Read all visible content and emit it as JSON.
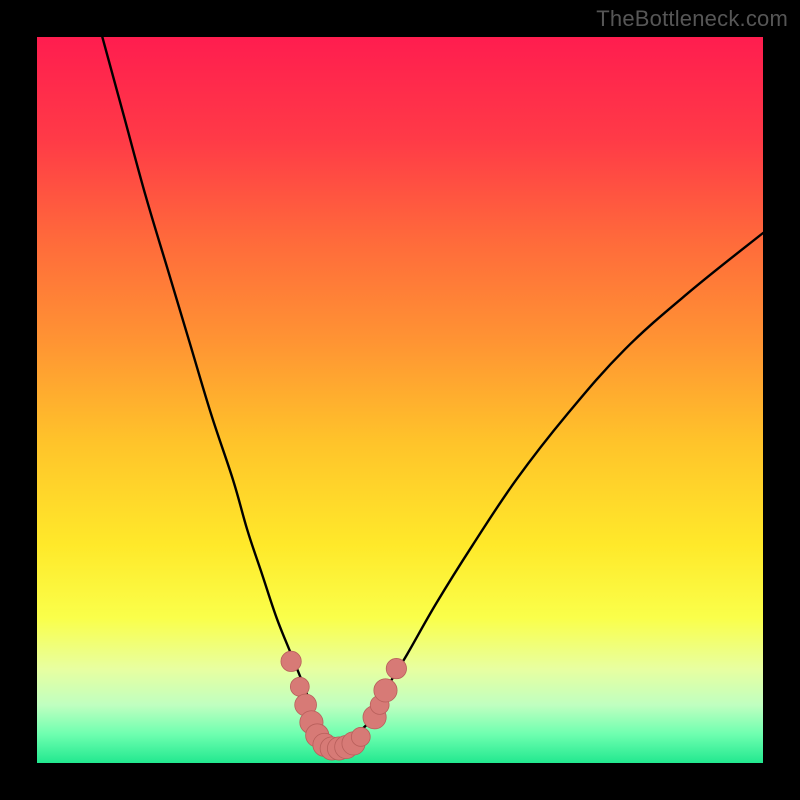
{
  "attribution": "TheBottleneck.com",
  "colors": {
    "black": "#000000",
    "curve": "#000000",
    "marker_fill": "#d77a76",
    "marker_stroke": "#b85f5b",
    "gradient_stops": [
      {
        "offset": 0.0,
        "color": "#ff1d4f"
      },
      {
        "offset": 0.14,
        "color": "#ff3a47"
      },
      {
        "offset": 0.28,
        "color": "#ff6a3b"
      },
      {
        "offset": 0.42,
        "color": "#ff9433"
      },
      {
        "offset": 0.56,
        "color": "#ffc42a"
      },
      {
        "offset": 0.7,
        "color": "#ffe92a"
      },
      {
        "offset": 0.8,
        "color": "#faff4a"
      },
      {
        "offset": 0.87,
        "color": "#e8ffa0"
      },
      {
        "offset": 0.92,
        "color": "#c0ffc0"
      },
      {
        "offset": 0.96,
        "color": "#6fffb0"
      },
      {
        "offset": 1.0,
        "color": "#22e88f"
      }
    ]
  },
  "chart_data": {
    "type": "line",
    "title": "",
    "xlabel": "",
    "ylabel": "",
    "xlim": [
      0,
      100
    ],
    "ylim": [
      0,
      100
    ],
    "grid": false,
    "legend": false,
    "series": [
      {
        "name": "bottleneck-curve",
        "x": [
          9,
          12,
          15,
          18,
          21,
          24,
          27,
          29,
          31,
          33,
          35,
          37,
          38,
          39,
          40,
          41,
          42,
          43,
          44,
          46,
          48,
          51,
          55,
          60,
          66,
          73,
          81,
          90,
          100
        ],
        "y": [
          100,
          89,
          78,
          68,
          58,
          48,
          39,
          32,
          26,
          20,
          15,
          10,
          7,
          5,
          3,
          2,
          2,
          3,
          4,
          6,
          10,
          15,
          22,
          30,
          39,
          48,
          57,
          65,
          73
        ]
      }
    ],
    "markers": [
      {
        "x": 35.0,
        "y": 14.0,
        "r": 1.4
      },
      {
        "x": 36.2,
        "y": 10.5,
        "r": 1.3
      },
      {
        "x": 37.0,
        "y": 8.0,
        "r": 1.5
      },
      {
        "x": 37.8,
        "y": 5.6,
        "r": 1.6
      },
      {
        "x": 38.6,
        "y": 3.8,
        "r": 1.6
      },
      {
        "x": 39.6,
        "y": 2.5,
        "r": 1.6
      },
      {
        "x": 40.6,
        "y": 2.0,
        "r": 1.6
      },
      {
        "x": 41.6,
        "y": 2.0,
        "r": 1.6
      },
      {
        "x": 42.6,
        "y": 2.2,
        "r": 1.6
      },
      {
        "x": 43.6,
        "y": 2.7,
        "r": 1.6
      },
      {
        "x": 44.6,
        "y": 3.6,
        "r": 1.3
      },
      {
        "x": 46.5,
        "y": 6.3,
        "r": 1.6
      },
      {
        "x": 47.2,
        "y": 8.0,
        "r": 1.3
      },
      {
        "x": 48.0,
        "y": 10.0,
        "r": 1.6
      },
      {
        "x": 49.5,
        "y": 13.0,
        "r": 1.4
      }
    ]
  }
}
